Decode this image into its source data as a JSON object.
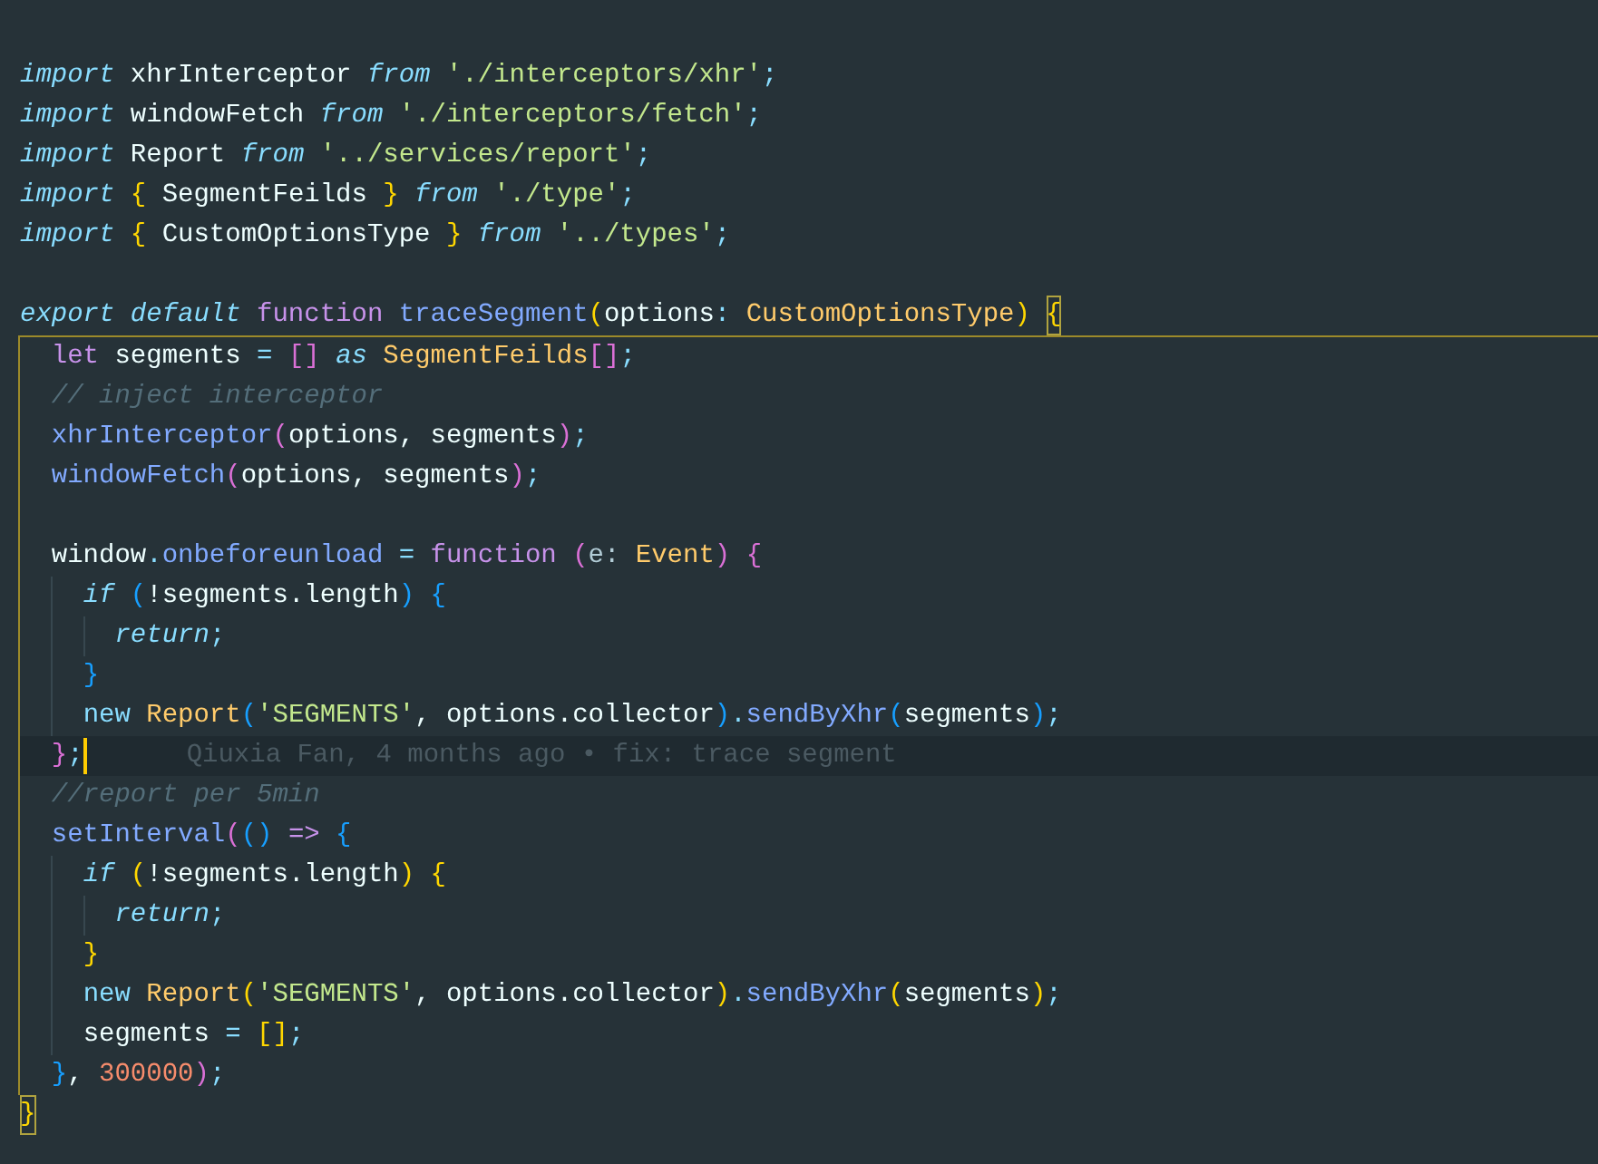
{
  "editor": {
    "lines": [
      {
        "kind": "blank"
      },
      {
        "kind": "code",
        "current": false,
        "tokens": [
          {
            "kind": "keyword",
            "text": "import"
          },
          {
            "kind": "plain",
            "text": " xhrInterceptor "
          },
          {
            "kind": "keyword",
            "text": "from"
          },
          {
            "kind": "string",
            "text": " './interceptors/xhr'"
          },
          {
            "kind": "operator",
            "text": ";"
          }
        ]
      },
      {
        "kind": "code",
        "current": false,
        "tokens": [
          {
            "kind": "keyword",
            "text": "import"
          },
          {
            "kind": "plain",
            "text": " windowFetch "
          },
          {
            "kind": "keyword",
            "text": "from"
          },
          {
            "kind": "string",
            "text": " './interceptors/fetch'"
          },
          {
            "kind": "operator",
            "text": ";"
          }
        ]
      },
      {
        "kind": "code",
        "current": false,
        "tokens": [
          {
            "kind": "keyword",
            "text": "import"
          },
          {
            "kind": "plain",
            "text": " Report "
          },
          {
            "kind": "keyword",
            "text": "from"
          },
          {
            "kind": "string",
            "text": " '../services/report'"
          },
          {
            "kind": "operator",
            "text": ";"
          }
        ]
      },
      {
        "kind": "code",
        "current": false,
        "tokens": [
          {
            "kind": "keyword",
            "text": "import"
          },
          {
            "kind": "bracket1",
            "text": " {"
          },
          {
            "kind": "plain",
            "text": " SegmentFeilds "
          },
          {
            "kind": "bracket1",
            "text": "}"
          },
          {
            "kind": "keyword",
            "text": " from"
          },
          {
            "kind": "string",
            "text": " './type'"
          },
          {
            "kind": "operator",
            "text": ";"
          }
        ]
      },
      {
        "kind": "code",
        "current": false,
        "tokens": [
          {
            "kind": "keyword",
            "text": "import"
          },
          {
            "kind": "bracket1",
            "text": " {"
          },
          {
            "kind": "plain",
            "text": " CustomOptionsType "
          },
          {
            "kind": "bracket1",
            "text": "}"
          },
          {
            "kind": "keyword",
            "text": " from"
          },
          {
            "kind": "string",
            "text": " '../types'"
          },
          {
            "kind": "operator",
            "text": ";"
          }
        ]
      },
      {
        "kind": "blank"
      },
      {
        "kind": "code",
        "current": false,
        "tokens": [
          {
            "kind": "keyword",
            "text": "export default "
          },
          {
            "kind": "storage",
            "text": "function "
          },
          {
            "kind": "function",
            "text": "traceSegment"
          },
          {
            "kind": "bracket1",
            "text": "("
          },
          {
            "kind": "plain",
            "text": "options"
          },
          {
            "kind": "operator",
            "text": ": "
          },
          {
            "kind": "type",
            "text": "CustomOptionsType"
          },
          {
            "kind": "bracket1",
            "text": ") "
          },
          {
            "kind": "bracket1",
            "text": "{",
            "matched": true
          }
        ]
      },
      {
        "kind": "code",
        "current": false,
        "tokens": [
          {
            "kind": "storage",
            "text": "  let "
          },
          {
            "kind": "plain",
            "text": "segments "
          },
          {
            "kind": "operator",
            "text": "= "
          },
          {
            "kind": "bracket2",
            "text": "[] "
          },
          {
            "kind": "keyword",
            "text": "as "
          },
          {
            "kind": "type",
            "text": "SegmentFeilds"
          },
          {
            "kind": "bracket2",
            "text": "[]"
          },
          {
            "kind": "operator",
            "text": ";"
          }
        ]
      },
      {
        "kind": "code",
        "current": false,
        "tokens": [
          {
            "kind": "comment",
            "text": "  // inject interceptor"
          }
        ]
      },
      {
        "kind": "code",
        "current": false,
        "tokens": [
          {
            "kind": "function",
            "text": "  xhrInterceptor"
          },
          {
            "kind": "bracket2",
            "text": "("
          },
          {
            "kind": "plain",
            "text": "options, segments"
          },
          {
            "kind": "bracket2",
            "text": ")"
          },
          {
            "kind": "operator",
            "text": ";"
          }
        ]
      },
      {
        "kind": "code",
        "current": false,
        "tokens": [
          {
            "kind": "function",
            "text": "  windowFetch"
          },
          {
            "kind": "bracket2",
            "text": "("
          },
          {
            "kind": "plain",
            "text": "options, segments"
          },
          {
            "kind": "bracket2",
            "text": ")"
          },
          {
            "kind": "operator",
            "text": ";"
          }
        ]
      },
      {
        "kind": "blank"
      },
      {
        "kind": "code",
        "current": false,
        "tokens": [
          {
            "kind": "plain",
            "text": "  window"
          },
          {
            "kind": "operator",
            "text": "."
          },
          {
            "kind": "function",
            "text": "onbeforeunload "
          },
          {
            "kind": "operator",
            "text": "= "
          },
          {
            "kind": "storage",
            "text": "function "
          },
          {
            "kind": "bracket2",
            "text": "("
          },
          {
            "kind": "param",
            "text": "e: "
          },
          {
            "kind": "type",
            "text": "Event"
          },
          {
            "kind": "bracket2",
            "text": ") {"
          }
        ]
      },
      {
        "kind": "code",
        "current": false,
        "tokens": [
          {
            "kind": "keyword",
            "text": "    if "
          },
          {
            "kind": "bracket3",
            "text": "("
          },
          {
            "kind": "plain",
            "text": "!segments.length"
          },
          {
            "kind": "bracket3",
            "text": ") {"
          }
        ]
      },
      {
        "kind": "code",
        "current": false,
        "tokens": [
          {
            "kind": "keyword",
            "text": "      return"
          },
          {
            "kind": "operator",
            "text": ";"
          }
        ]
      },
      {
        "kind": "code",
        "current": false,
        "tokens": [
          {
            "kind": "bracket3",
            "text": "    }"
          }
        ]
      },
      {
        "kind": "code",
        "current": false,
        "tokens": [
          {
            "kind": "operator",
            "text": "    new "
          },
          {
            "kind": "type",
            "text": "Report"
          },
          {
            "kind": "bracket3",
            "text": "("
          },
          {
            "kind": "string",
            "text": "'SEGMENTS'"
          },
          {
            "kind": "plain",
            "text": ", options.collector"
          },
          {
            "kind": "bracket3",
            "text": ")"
          },
          {
            "kind": "operator",
            "text": "."
          },
          {
            "kind": "function",
            "text": "sendByXhr"
          },
          {
            "kind": "bracket3",
            "text": "("
          },
          {
            "kind": "plain",
            "text": "segments"
          },
          {
            "kind": "bracket3",
            "text": ")"
          },
          {
            "kind": "operator",
            "text": ";"
          }
        ]
      },
      {
        "kind": "code",
        "current": true,
        "annotation": "Qiuxia Fan, 4 months ago • fix: trace segment",
        "tokens": [
          {
            "kind": "bracket2",
            "text": "  }"
          },
          {
            "kind": "operator",
            "text": ";"
          }
        ]
      },
      {
        "kind": "code",
        "current": false,
        "tokens": [
          {
            "kind": "comment",
            "text": "  //report per 5min"
          }
        ]
      },
      {
        "kind": "code",
        "current": false,
        "tokens": [
          {
            "kind": "function",
            "text": "  setInterval"
          },
          {
            "kind": "bracket2",
            "text": "("
          },
          {
            "kind": "bracket3",
            "text": "() "
          },
          {
            "kind": "storage",
            "text": "=> "
          },
          {
            "kind": "bracket3",
            "text": "{"
          }
        ]
      },
      {
        "kind": "code",
        "current": false,
        "tokens": [
          {
            "kind": "keyword",
            "text": "    if "
          },
          {
            "kind": "bracket1",
            "text": "("
          },
          {
            "kind": "plain",
            "text": "!segments.length"
          },
          {
            "kind": "bracket1",
            "text": ") {"
          }
        ]
      },
      {
        "kind": "code",
        "current": false,
        "tokens": [
          {
            "kind": "keyword",
            "text": "      return"
          },
          {
            "kind": "operator",
            "text": ";"
          }
        ]
      },
      {
        "kind": "code",
        "current": false,
        "tokens": [
          {
            "kind": "bracket1",
            "text": "    }"
          }
        ]
      },
      {
        "kind": "code",
        "current": false,
        "tokens": [
          {
            "kind": "operator",
            "text": "    new "
          },
          {
            "kind": "type",
            "text": "Report"
          },
          {
            "kind": "bracket1",
            "text": "("
          },
          {
            "kind": "string",
            "text": "'SEGMENTS'"
          },
          {
            "kind": "plain",
            "text": ", options.collector"
          },
          {
            "kind": "bracket1",
            "text": ")"
          },
          {
            "kind": "operator",
            "text": "."
          },
          {
            "kind": "function",
            "text": "sendByXhr"
          },
          {
            "kind": "bracket1",
            "text": "("
          },
          {
            "kind": "plain",
            "text": "segments"
          },
          {
            "kind": "bracket1",
            "text": ")"
          },
          {
            "kind": "operator",
            "text": ";"
          }
        ]
      },
      {
        "kind": "code",
        "current": false,
        "tokens": [
          {
            "kind": "plain",
            "text": "    segments "
          },
          {
            "kind": "operator",
            "text": "= "
          },
          {
            "kind": "bracket1",
            "text": "[]"
          },
          {
            "kind": "operator",
            "text": ";"
          }
        ]
      },
      {
        "kind": "code",
        "current": false,
        "tokens": [
          {
            "kind": "bracket3",
            "text": "  }"
          },
          {
            "kind": "plain",
            "text": ", "
          },
          {
            "kind": "number",
            "text": "300000"
          },
          {
            "kind": "bracket2",
            "text": ")"
          },
          {
            "kind": "operator",
            "text": ";"
          }
        ]
      },
      {
        "kind": "code",
        "current": false,
        "tokens": [
          {
            "kind": "bracket1",
            "text": "}",
            "matched": true
          }
        ]
      }
    ]
  }
}
